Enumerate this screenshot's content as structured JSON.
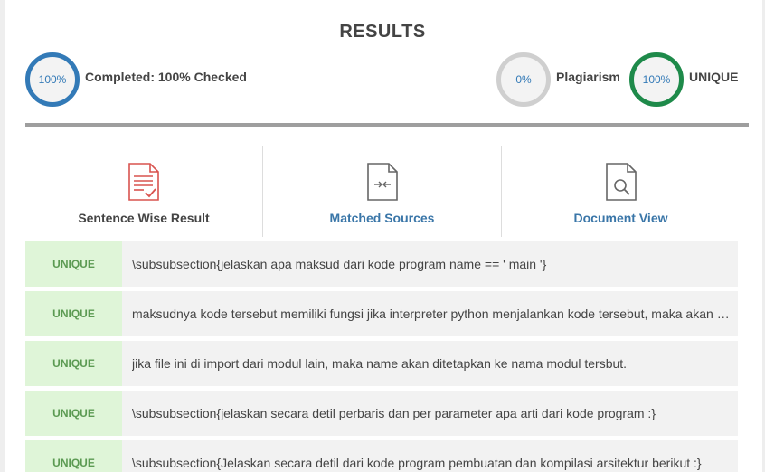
{
  "header": {
    "title": "RESULTS"
  },
  "stats": {
    "completed": {
      "percent": "100%",
      "label": "Completed: 100% Checked",
      "color": "#337ab7"
    },
    "plagiarism": {
      "percent": "0%",
      "label": "Plagiarism",
      "color": "#cfcfcf"
    },
    "unique": {
      "percent": "100%",
      "label": "UNIQUE",
      "color": "#1e8a4a"
    }
  },
  "tabs": [
    {
      "label": "Sentence Wise Result",
      "icon": "document-check-icon"
    },
    {
      "label": "Matched Sources",
      "icon": "document-compare-icon"
    },
    {
      "label": "Document View",
      "icon": "document-search-icon"
    }
  ],
  "results": [
    {
      "status": "UNIQUE",
      "text": "\\subsubsection{jelaskan apa maksud dari kode program name == ' main '}"
    },
    {
      "status": "UNIQUE",
      "text": "maksudnya kode tersebut memiliki fungsi jika interpreter python menjalankan kode tersebut, maka akan menjalankan kode di dalamnya"
    },
    {
      "status": "UNIQUE",
      "text": "jika file ini di import dari modul lain, maka name akan ditetapkan ke nama modul tersbut."
    },
    {
      "status": "UNIQUE",
      "text": "\\subsubsection{jelaskan secara detil perbaris dan per parameter apa arti dari kode program :}"
    },
    {
      "status": "UNIQUE",
      "text": "\\subsubsection{Jelaskan secara detil dari kode program pembuatan dan kompilasi arsitektur berikut :}"
    }
  ],
  "colors": {
    "accent_blue": "#337ab7",
    "unique_badge_bg": "#dff5d8",
    "unique_badge_text": "#5b9a52",
    "link": "#3a76a8"
  }
}
